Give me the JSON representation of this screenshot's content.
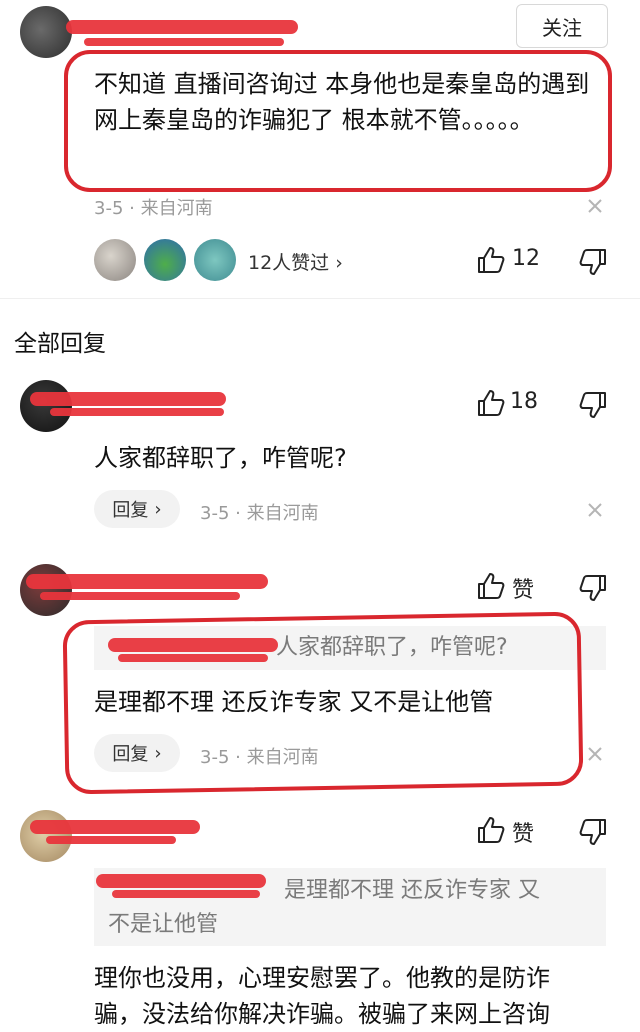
{
  "top_comment": {
    "follow_label": "关注",
    "text": "不知道 直播间咨询过 本身他也是秦皇岛的遇到网上秦皇岛的诈骗犯了 根本就不管。。。。。",
    "meta": "3-5 · 来自河南",
    "likers_label": "12人赞过",
    "like_count": "12"
  },
  "section_title": "全部回复",
  "replies": [
    {
      "text": "人家都辞职了，咋管呢?",
      "like_count": "18",
      "reply_label": "回复",
      "meta": "3-5 · 来自河南"
    },
    {
      "quote": "人家都辞职了，咋管呢?",
      "text": "是理都不理 还反诈专家 又不是让他管",
      "like_label": "赞",
      "reply_label": "回复",
      "meta": "3-5 · 来自河南"
    },
    {
      "quote_line1": "是理都不理 还反诈专家 又",
      "quote_line2": "不是让他管",
      "text_line1": "理你也没用，心理安慰罢了。他教的是防诈",
      "text_line2": "骗，没法给你解决诈骗。被骗了来网上咨询",
      "like_label": "赞"
    }
  ],
  "colors": {
    "highlight": "#d9272e",
    "redaction": "#e8353c"
  }
}
